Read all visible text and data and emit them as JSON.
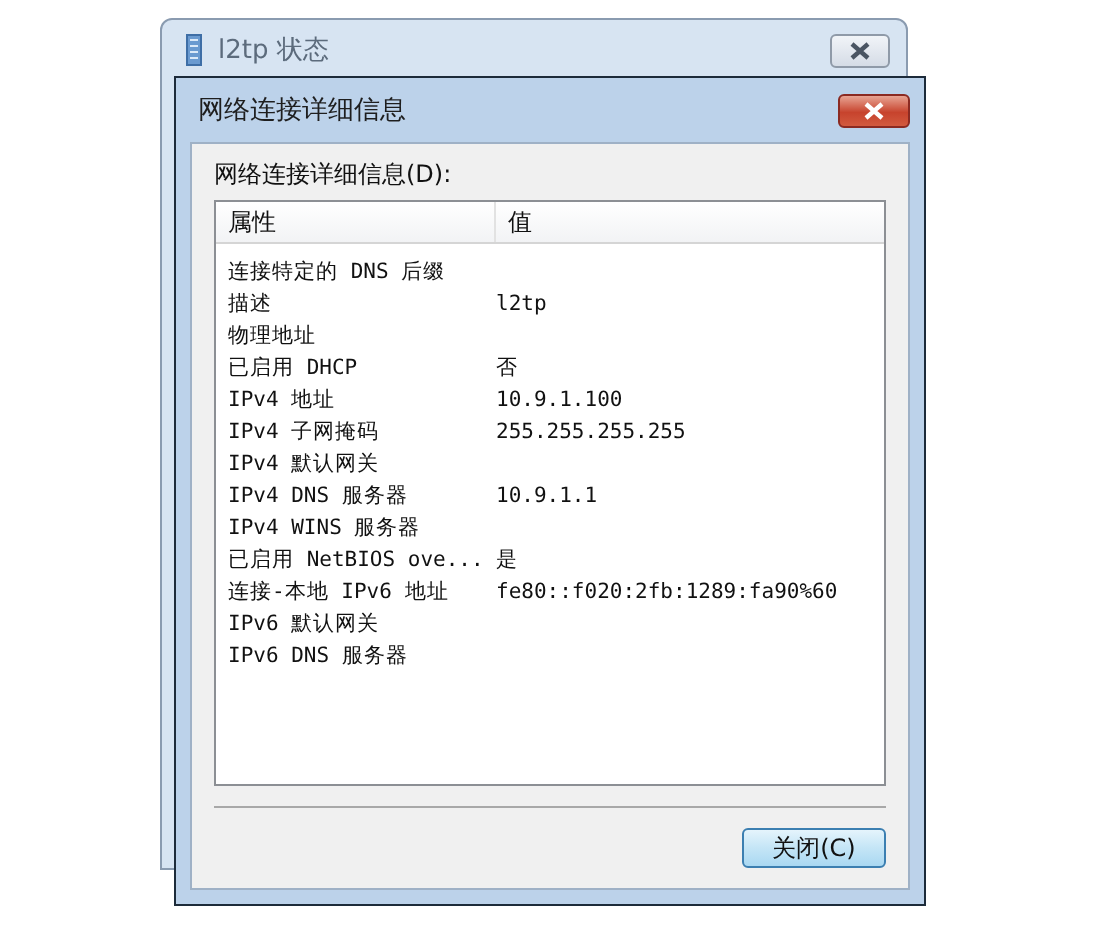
{
  "back_window": {
    "title": "l2tp 状态"
  },
  "dialog": {
    "title": "网络连接详细信息",
    "list_label": "网络连接详细信息(D):",
    "columns": [
      "属性",
      "值"
    ],
    "rows": [
      {
        "property": "连接特定的 DNS 后缀",
        "value": ""
      },
      {
        "property": "描述",
        "value": "l2tp"
      },
      {
        "property": "物理地址",
        "value": ""
      },
      {
        "property": "已启用 DHCP",
        "value": "否"
      },
      {
        "property": "IPv4 地址",
        "value": "10.9.1.100"
      },
      {
        "property": "IPv4 子网掩码",
        "value": "255.255.255.255"
      },
      {
        "property": "IPv4 默认网关",
        "value": ""
      },
      {
        "property": "IPv4 DNS 服务器",
        "value": "10.9.1.1"
      },
      {
        "property": "IPv4 WINS 服务器",
        "value": ""
      },
      {
        "property": "已启用 NetBIOS ove...",
        "value": "是"
      },
      {
        "property": "连接-本地 IPv6 地址",
        "value": "fe80::f020:2fb:1289:fa90%60"
      },
      {
        "property": "IPv6 默认网关",
        "value": ""
      },
      {
        "property": "IPv6 DNS 服务器",
        "value": ""
      }
    ],
    "close_button": "关闭(C)"
  }
}
